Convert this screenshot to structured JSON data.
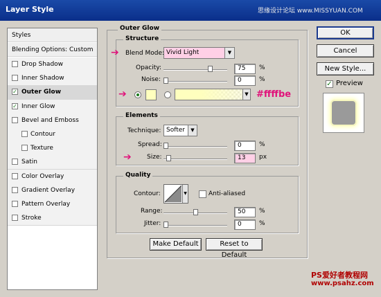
{
  "window": {
    "title": "Layer Style",
    "watermark": "思缘设计论坛 www.MISSYUAN.COM"
  },
  "styles_list": {
    "header": "Styles",
    "blending": "Blending Options: Custom",
    "items": [
      {
        "label": "Drop Shadow",
        "checked": false
      },
      {
        "label": "Inner Shadow",
        "checked": false
      },
      {
        "label": "Outer Glow",
        "checked": true,
        "selected": true
      },
      {
        "label": "Inner Glow",
        "checked": true
      },
      {
        "label": "Bevel and Emboss",
        "checked": false
      },
      {
        "label": "Contour",
        "checked": false,
        "indent": true
      },
      {
        "label": "Texture",
        "checked": false,
        "indent": true
      },
      {
        "label": "Satin",
        "checked": false
      },
      {
        "label": "Color Overlay",
        "checked": false
      },
      {
        "label": "Gradient Overlay",
        "checked": false
      },
      {
        "label": "Pattern Overlay",
        "checked": false
      },
      {
        "label": "Stroke",
        "checked": false
      }
    ]
  },
  "buttons": {
    "ok": "OK",
    "cancel": "Cancel",
    "new_style": "New Style...",
    "preview": "Preview",
    "preview_checked": true
  },
  "outer_glow": {
    "title": "Outer Glow",
    "structure": {
      "title": "Structure",
      "blend_mode_label": "Blend Mode:",
      "blend_mode_value": "Vivid Light",
      "opacity_label": "Opacity:",
      "opacity_value": "75",
      "opacity_fraction": 0.75,
      "noise_label": "Noise:",
      "noise_value": "0",
      "noise_fraction": 0.0,
      "percent": "%",
      "color_annotation": "#ffffbe",
      "swatch_color": "#ffffbe"
    },
    "elements": {
      "title": "Elements",
      "technique_label": "Technique:",
      "technique_value": "Softer",
      "spread_label": "Spread:",
      "spread_value": "0",
      "spread_fraction": 0.0,
      "size_label": "Size:",
      "size_value": "13",
      "size_fraction": 0.05,
      "percent": "%",
      "px": "px"
    },
    "quality": {
      "title": "Quality",
      "contour_label": "Contour:",
      "anti_aliased_label": "Anti-aliased",
      "range_label": "Range:",
      "range_value": "50",
      "range_fraction": 0.5,
      "jitter_label": "Jitter:",
      "jitter_value": "0",
      "jitter_fraction": 0.0,
      "percent": "%"
    },
    "make_default": "Make Default",
    "reset_default": "Reset to Default"
  },
  "footer_watermark": {
    "line1": "PS爱好者教程网",
    "line2": "www.psahz.com"
  },
  "colors": {
    "accent_arrow": "#e0127a",
    "glow": "#ffffbe"
  }
}
